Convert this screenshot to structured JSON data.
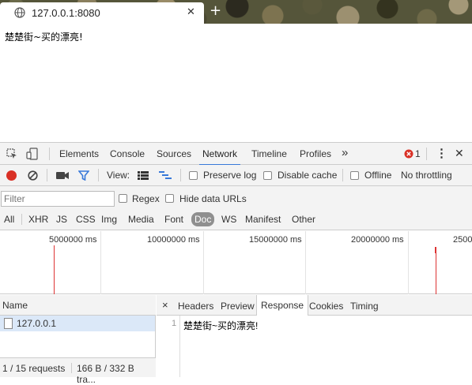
{
  "browser": {
    "tab_title": "127.0.0.1:8080",
    "close_glyph": "✕",
    "new_tab_glyph": "+"
  },
  "page": {
    "text": "楚楚街~买的漂亮!"
  },
  "devtools": {
    "main_tabs": [
      "Elements",
      "Console",
      "Sources",
      "Network",
      "Timeline",
      "Profiles"
    ],
    "active_tab": "Network",
    "overflow_glyph": "»",
    "error_count": "1",
    "kebab_glyph": "⋮",
    "close_glyph": "✕",
    "toolbar": {
      "view_label": "View:",
      "preserve_log": "Preserve log",
      "disable_cache": "Disable cache",
      "offline": "Offline",
      "throttling": "No throttling"
    },
    "filter": {
      "placeholder": "Filter",
      "regex": "Regex",
      "hide_data_urls": "Hide data URLs"
    },
    "types": [
      "All",
      "XHR",
      "JS",
      "CSS",
      "Img",
      "Media",
      "Font",
      "Doc",
      "WS",
      "Manifest",
      "Other"
    ],
    "selected_type": "Doc",
    "timeline_labels": [
      "5000000 ms",
      "10000000 ms",
      "15000000 ms",
      "20000000 ms",
      "2500"
    ],
    "requests": {
      "name_header": "Name",
      "rows": [
        "127.0.0.1"
      ],
      "status": "1 / 15 requests",
      "transfer": "166 B / 332 B tra..."
    },
    "detail": {
      "close_glyph": "×",
      "tabs": [
        "Headers",
        "Preview",
        "Response",
        "Cookies",
        "Timing"
      ],
      "active_tab": "Response",
      "line_number": "1",
      "response_text": "楚楚街~买的漂亮!"
    },
    "colors": {
      "record_red": "#d93025",
      "accent_blue": "#3879d9",
      "selected_row": "#dbe8f8",
      "error_red": "#d93025"
    }
  }
}
